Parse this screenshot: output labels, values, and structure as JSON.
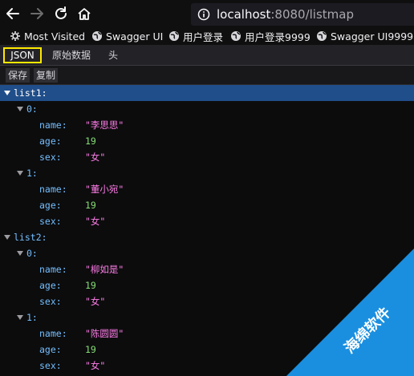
{
  "browser": {
    "url_host": "localhost",
    "url_rest": ":8080/listmap",
    "bookmarks": [
      "Most Visited",
      "Swagger UI",
      "用户登录",
      "用户登录9999",
      "Swagger UI9999"
    ]
  },
  "viewer": {
    "tabs": [
      "JSON",
      "原始数据",
      "头"
    ],
    "selected_tab": "JSON",
    "toolbar": [
      "保存",
      "复制"
    ]
  },
  "json": {
    "list1": [
      {
        "index": "0",
        "name": "\"李思思\"",
        "age": "19",
        "sex": "\"女\""
      },
      {
        "index": "1",
        "name": "\"董小宛\"",
        "age": "19",
        "sex": "\"女\""
      }
    ],
    "list2": [
      {
        "index": "0",
        "name": "\"柳如是\"",
        "age": "19",
        "sex": "\"女\""
      },
      {
        "index": "1",
        "name": "\"陈圆圆\"",
        "age": "19",
        "sex": "\"女\""
      }
    ]
  },
  "labels": {
    "list1": "list1:",
    "list2": "list2:",
    "name": "name:",
    "age": "age:",
    "sex": "sex:",
    "idx0": "0:",
    "idx1": "1:"
  },
  "watermark": "海绵软件",
  "colors": {
    "selected_row": "#204e8a",
    "key": "#75bfff",
    "string": "#ff7de9",
    "number": "#86de74",
    "tab_highlight": "#ffe900",
    "watermark": "#1a8fe0"
  },
  "icons": [
    "back-arrow-icon",
    "forward-arrow-icon",
    "reload-icon",
    "home-icon",
    "info-icon",
    "gear-icon",
    "globe-icon"
  ]
}
